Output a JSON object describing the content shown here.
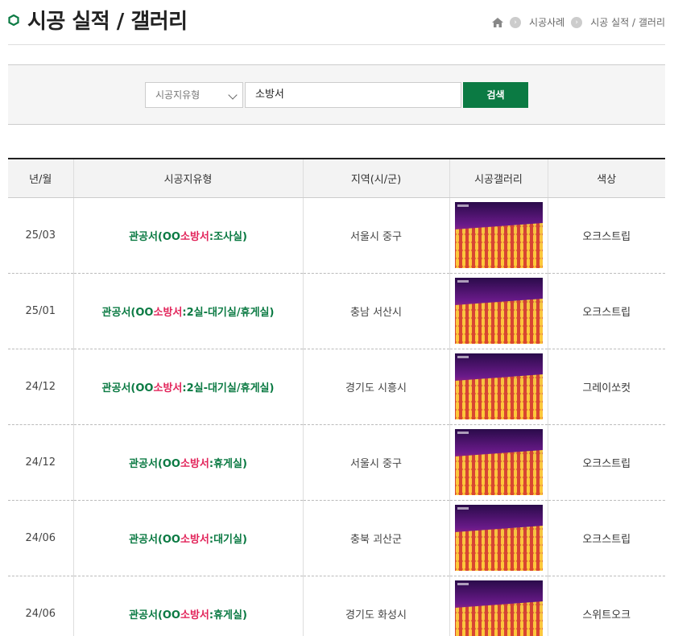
{
  "header": {
    "title": "시공 실적 / 갤러리",
    "breadcrumb": [
      "시공사례",
      "시공 실적 / 갤러리"
    ]
  },
  "search": {
    "select_value": "시공지유형",
    "input_value": "소방서",
    "button_label": "검색"
  },
  "table": {
    "columns": [
      "년/월",
      "시공지유형",
      "지역(시/군)",
      "시공갤러리",
      "색상"
    ],
    "rows": [
      {
        "date": "25/03",
        "type_prefix": "관공서(OO",
        "type_hl": "소방서",
        "type_suffix": ":조사실)",
        "region": "서울시 중구",
        "color": "오크스트립"
      },
      {
        "date": "25/01",
        "type_prefix": "관공서(OO",
        "type_hl": "소방서",
        "type_suffix": ":2실-대기실/휴게실)",
        "region": "충남 서산시",
        "color": "오크스트립"
      },
      {
        "date": "24/12",
        "type_prefix": "관공서(OO",
        "type_hl": "소방서",
        "type_suffix": ":2실-대기실/휴게실)",
        "region": "경기도 시흥시",
        "color": "그레이쏘컷"
      },
      {
        "date": "24/12",
        "type_prefix": "관공서(OO",
        "type_hl": "소방서",
        "type_suffix": ":휴게실)",
        "region": "서울시 중구",
        "color": "오크스트립"
      },
      {
        "date": "24/06",
        "type_prefix": "관공서(OO",
        "type_hl": "소방서",
        "type_suffix": ":대기실)",
        "region": "충북 괴산군",
        "color": "오크스트립"
      },
      {
        "date": "24/06",
        "type_prefix": "관공서(OO",
        "type_hl": "소방서",
        "type_suffix": ":휴게실)",
        "region": "경기도 화성시",
        "color": "스위트오크"
      }
    ]
  },
  "colors": {
    "accent": "#0b7a43",
    "highlight": "#e2245a"
  },
  "icons": {
    "title": "hexagon-icon",
    "home": "home-icon",
    "separator": "chevron-right-icon",
    "select": "chevron-down-icon",
    "thumbnail": "thermal-image"
  }
}
